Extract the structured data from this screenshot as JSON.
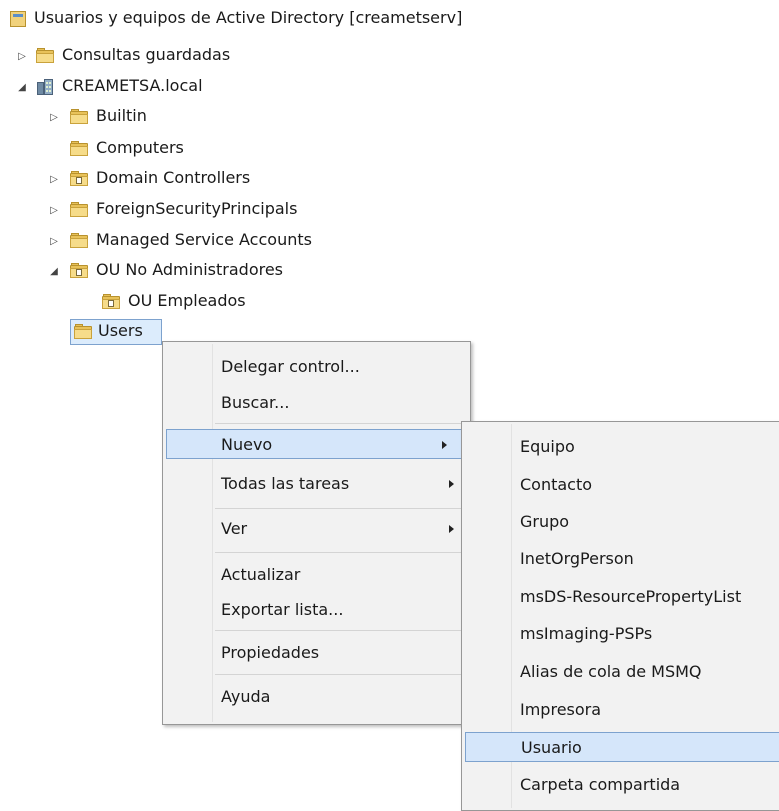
{
  "tree": {
    "root_label": "Usuarios y equipos de Active Directory [creametserv]",
    "saved_queries": "Consultas guardadas",
    "domain": "CREAMETSA.local",
    "builtin": "Builtin",
    "computers": "Computers",
    "domain_controllers": "Domain Controllers",
    "foreign_security_principals": "ForeignSecurityPrincipals",
    "managed_service_accounts": "Managed Service Accounts",
    "ou_no_admin": "OU No Administradores",
    "ou_empleados": "OU Empleados",
    "users": "Users"
  },
  "context_menu": {
    "delegate_control": "Delegar control...",
    "search": "Buscar...",
    "new": "Nuevo",
    "all_tasks": "Todas las tareas",
    "view": "Ver",
    "refresh": "Actualizar",
    "export_list": "Exportar lista...",
    "properties": "Propiedades",
    "help": "Ayuda"
  },
  "submenu": {
    "computer": "Equipo",
    "contact": "Contacto",
    "group": "Grupo",
    "inet_org_person": "InetOrgPerson",
    "ms_ds_resource_property_list": "msDS-ResourcePropertyList",
    "ms_imaging_psps": "msImaging-PSPs",
    "msmq_queue_alias": "Alias de cola de MSMQ",
    "printer": "Impresora",
    "user": "Usuario",
    "shared_folder": "Carpeta compartida"
  }
}
